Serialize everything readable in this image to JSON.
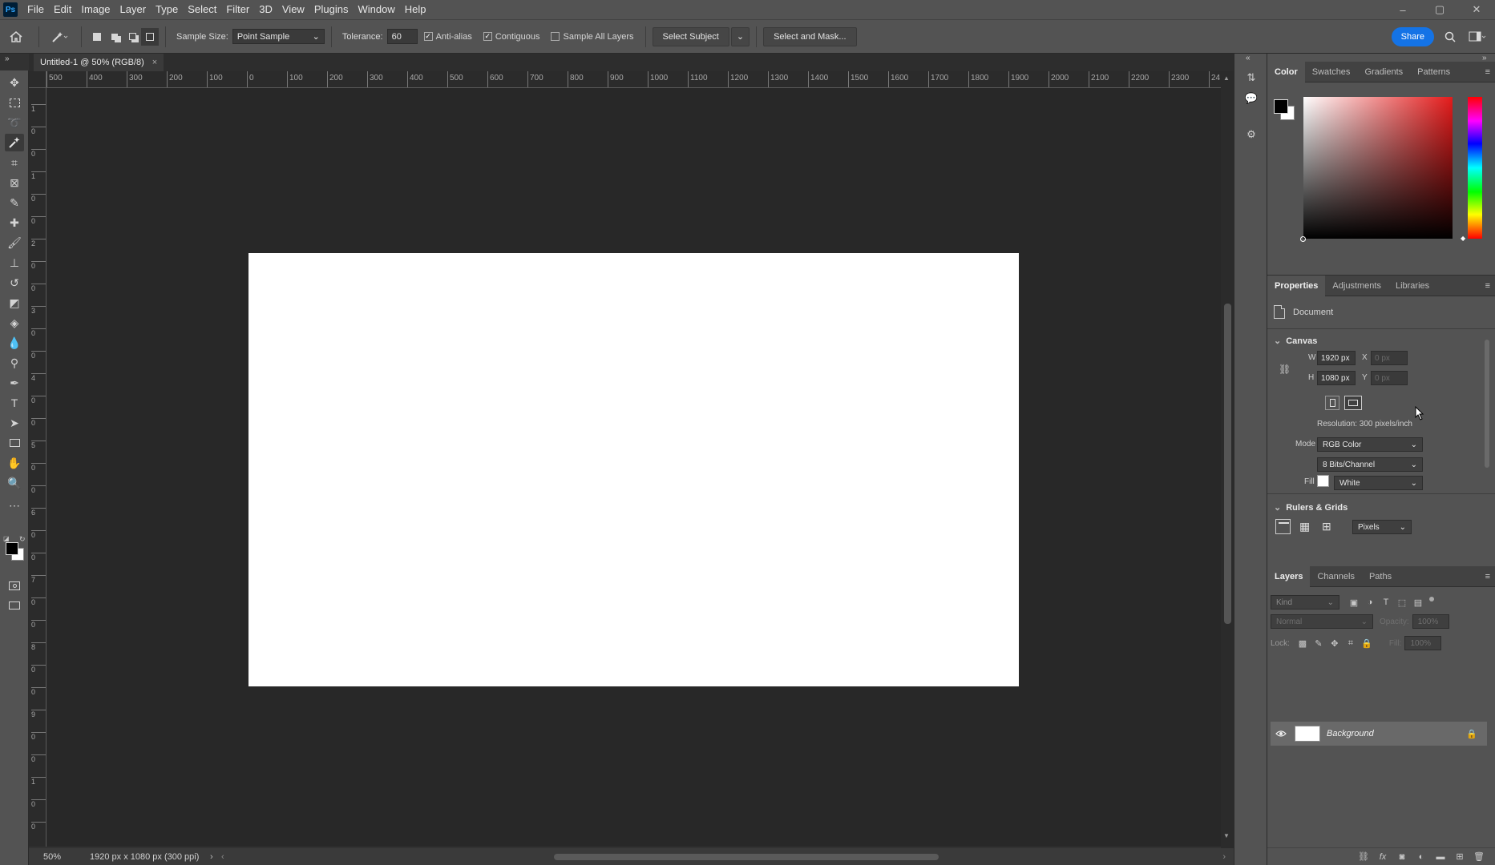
{
  "menubar": {
    "app_icon": "Ps",
    "items": [
      "File",
      "Edit",
      "Image",
      "Layer",
      "Type",
      "Select",
      "Filter",
      "3D",
      "View",
      "Plugins",
      "Window",
      "Help"
    ],
    "window_controls": [
      "–",
      "▢",
      "✕"
    ]
  },
  "options": {
    "sample_size_label": "Sample Size:",
    "sample_size_value": "Point Sample",
    "tolerance_label": "Tolerance:",
    "tolerance_value": "60",
    "anti_alias_label": "Anti-alias",
    "anti_alias_checked": true,
    "contiguous_label": "Contiguous",
    "contiguous_checked": true,
    "sample_all_label": "Sample All Layers",
    "sample_all_checked": false,
    "select_subject_label": "Select Subject",
    "select_mask_label": "Select and Mask...",
    "share_label": "Share"
  },
  "document": {
    "tab_title": "Untitled-1 @ 50% (RGB/8)",
    "tab_close": "×"
  },
  "ruler": {
    "h_labels": [
      "500",
      "400",
      "300",
      "200",
      "100",
      "0",
      "100",
      "200",
      "300",
      "400",
      "500",
      "600",
      "700",
      "800",
      "900",
      "1000",
      "1100",
      "1200",
      "1300",
      "1400",
      "1500",
      "1600",
      "1700",
      "1800",
      "1900",
      "2000",
      "2100",
      "2200",
      "2300",
      "24"
    ],
    "v_labels": [
      "1",
      "0",
      "0",
      "1",
      "0",
      "0",
      "2",
      "0",
      "0",
      "3",
      "0",
      "0",
      "4",
      "0",
      "0",
      "5",
      "0",
      "0",
      "6",
      "0",
      "0",
      "7",
      "0",
      "0",
      "8",
      "0",
      "0",
      "9",
      "0",
      "0",
      "1",
      "0",
      "0"
    ]
  },
  "status": {
    "zoom": "50%",
    "doc_info": "1920 px x 1080 px (300 ppi)",
    "arrow": "›",
    "scroll_left": "‹",
    "scroll_right": "›"
  },
  "color_panel": {
    "tabs": [
      "Color",
      "Swatches",
      "Gradients",
      "Patterns"
    ],
    "fg_color": "#000000",
    "bg_color": "#ffffff"
  },
  "properties_panel": {
    "tabs": [
      "Properties",
      "Adjustments",
      "Libraries"
    ],
    "doc_label": "Document",
    "canvas_heading": "Canvas",
    "w_label": "W",
    "w_value": "1920 px",
    "h_label": "H",
    "h_value": "1080 px",
    "x_label": "X",
    "x_value": "0 px",
    "y_label": "Y",
    "y_value": "0 px",
    "resolution": "Resolution: 300 pixels/inch",
    "mode_label": "Mode",
    "mode_value": "RGB Color",
    "depth_value": "8 Bits/Channel",
    "fill_label": "Fill",
    "fill_value": "White",
    "rulers_heading": "Rulers & Grids",
    "units_value": "Pixels"
  },
  "layers_panel": {
    "tabs": [
      "Layers",
      "Channels",
      "Paths"
    ],
    "kind_placeholder": "Kind",
    "blend_value": "Normal",
    "opacity_label": "Opacity:",
    "opacity_value": "100%",
    "lock_label": "Lock:",
    "fill_label": "Fill:",
    "fill_value": "100%",
    "layer_name": "Background"
  },
  "colors": {
    "accent": "#1473e6",
    "panel_bg": "#535353",
    "canvas_bg": "#282828",
    "document": "#ffffff"
  }
}
